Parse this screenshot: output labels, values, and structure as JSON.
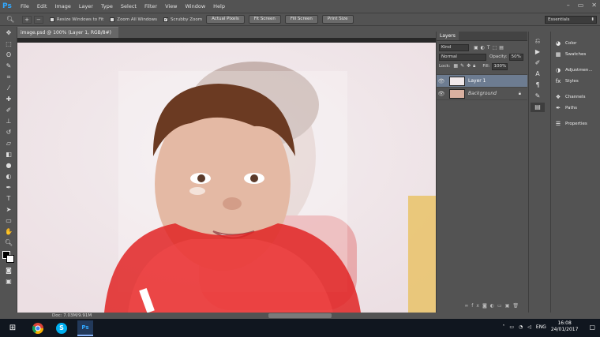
{
  "app": {
    "logo": "Ps"
  },
  "menu": [
    "File",
    "Edit",
    "Image",
    "Layer",
    "Type",
    "Select",
    "Filter",
    "View",
    "Window",
    "Help"
  ],
  "window_controls": [
    "–",
    "▭",
    "✕"
  ],
  "options": {
    "check_resize": "Resize Windows to Fit",
    "check_zoom_all": "Zoom All Windows",
    "check_scrubby": "Scrubby Zoom",
    "btn_actual": "Actual Pixels",
    "btn_fit": "Fit Screen",
    "btn_fill": "Fill Screen",
    "btn_print": "Print Size",
    "workspace": "Essentials"
  },
  "document": {
    "tab_title": "image.psd @ 100% (Layer 1, RGB/8#) *",
    "status": "Doc: 7.03M/9.91M"
  },
  "layers_panel": {
    "tab": "Layers",
    "kind": "Kind",
    "blend_mode": "Normal",
    "opacity_label": "Opacity:",
    "opacity_value": "50%",
    "lock_label": "Lock:",
    "fill_label": "Fill:",
    "fill_value": "100%",
    "layers": [
      {
        "name": "Layer 1",
        "selected": true
      },
      {
        "name": "Background",
        "selected": false
      }
    ]
  },
  "right_panels": {
    "items": [
      {
        "label": "Color",
        "icon": "color-icon"
      },
      {
        "label": "Swatches",
        "icon": "swatches-icon"
      },
      {
        "label": "Adjustmen...",
        "icon": "adjustments-icon"
      },
      {
        "label": "Styles",
        "icon": "styles-icon"
      },
      {
        "label": "Channels",
        "icon": "channels-icon"
      },
      {
        "label": "Paths",
        "icon": "paths-icon"
      },
      {
        "label": "Properties",
        "icon": "properties-icon"
      }
    ]
  },
  "taskbar": {
    "lang": "ENG",
    "time": "16:08",
    "date": "24/01/2017"
  },
  "colors": {
    "selection": "#6d7c91",
    "ps_blue": "#31a8ff"
  }
}
